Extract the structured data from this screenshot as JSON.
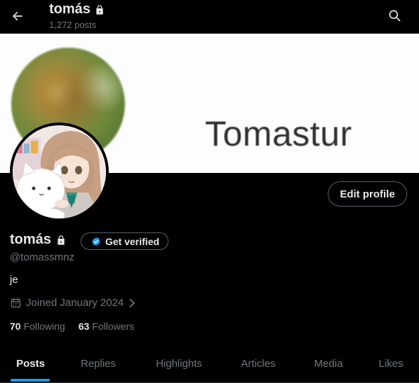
{
  "header": {
    "name": "tomás",
    "post_count": "1,272 posts"
  },
  "banner": {
    "text": "Tomastur"
  },
  "profile": {
    "edit_label": "Edit profile",
    "display_name": "tomás",
    "verify_label": "Get verified",
    "handle": "@tomassmnz",
    "bio": "je",
    "joined": "Joined January 2024",
    "following_count": "70",
    "following_label": "Following",
    "followers_count": "63",
    "followers_label": "Followers"
  },
  "tabs": [
    {
      "label": "Posts",
      "active": true
    },
    {
      "label": "Replies"
    },
    {
      "label": "Highlights"
    },
    {
      "label": "Articles"
    },
    {
      "label": "Media"
    },
    {
      "label": "Likes"
    }
  ],
  "colors": {
    "background": "#000000",
    "primary_text": "#e7e9ea",
    "secondary_text": "#71767b",
    "accent": "#1d9bf0",
    "border": "#536471"
  },
  "icons": {
    "back": "arrow-left-icon",
    "lock": "lock-icon",
    "search": "search-icon",
    "verified": "verified-badge-icon",
    "calendar": "calendar-icon",
    "chevron": "chevron-right-icon"
  }
}
